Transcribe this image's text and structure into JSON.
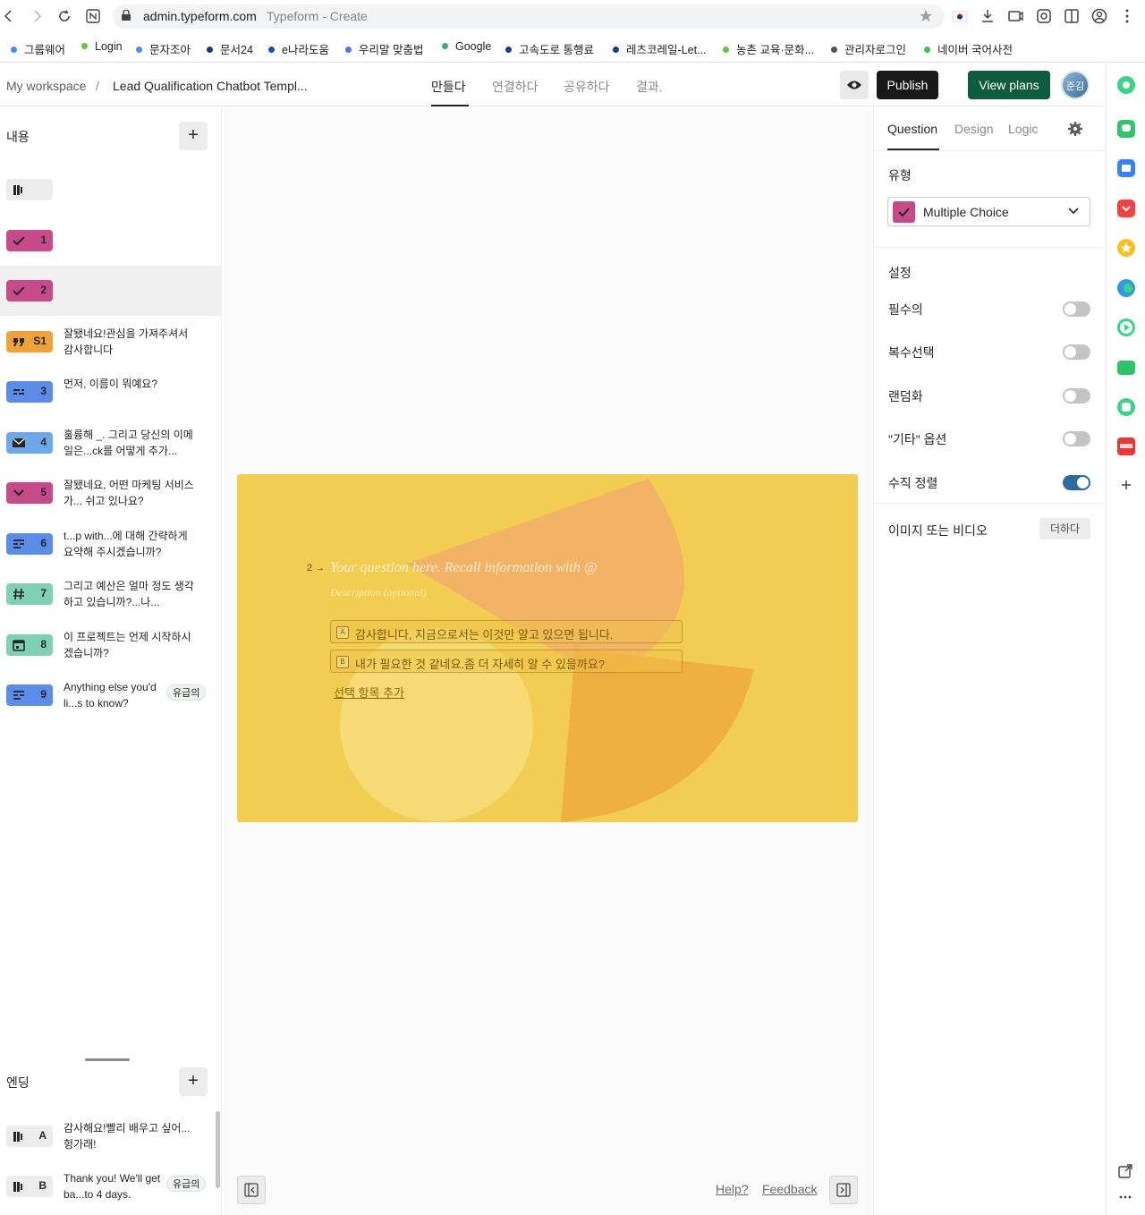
{
  "browser": {
    "url_domain": "admin.typeform.com",
    "page_title": "Typeform - Create",
    "bookmarks": [
      {
        "label": "그룹웨어",
        "color": "#4a8fe7"
      },
      {
        "label": "Login",
        "color": "#6abf4b"
      },
      {
        "label": "문자조아",
        "color": "#4a8fe7"
      },
      {
        "label": "문서24",
        "color": "#1c3a78"
      },
      {
        "label": "e나라도움",
        "color": "#1e4fa8"
      },
      {
        "label": "우리말 맞춤법",
        "color": "#5b6ee0"
      },
      {
        "label": "Google",
        "color": "#46a37a"
      },
      {
        "label": "고속도로 통행료",
        "color": "#1a3c82"
      },
      {
        "label": "레츠코레일-Let...",
        "color": "#1a3c82"
      },
      {
        "label": "농촌 교육·문화...",
        "color": "#6abf4b"
      },
      {
        "label": "관리자로그인",
        "color": "#555555"
      },
      {
        "label": "네이버 국어사전",
        "color": "#3cc35a"
      }
    ]
  },
  "header": {
    "workspace": "My workspace",
    "separator": "/",
    "form_name": "Lead Qualification Chatbot Templ...",
    "tabs": [
      "만들다",
      "연결하다",
      "공유하다",
      "결과."
    ],
    "publish_label": "Publish",
    "plans_label": "View plans",
    "avatar_text": "준김"
  },
  "left": {
    "content_label": "내용",
    "ending_label": "엔딩",
    "questions": [
      {
        "num": "",
        "text": "",
        "color": "#ececec",
        "icon": "welcome-screen-icon"
      },
      {
        "num": "1",
        "text": "",
        "color": "#c74b8b",
        "icon": "checkmark-icon"
      },
      {
        "num": "2",
        "text": "",
        "color": "#c74b8b",
        "icon": "checkmark-icon"
      },
      {
        "num": "S1",
        "text": "잘됐네요!관심을 가져주셔서 감사합니다",
        "color": "#f0a23a",
        "icon": "quote-icon"
      },
      {
        "num": "3",
        "text": "먼저, 이름이 뭐예요?",
        "color": "#5b8de8",
        "icon": "short-text-icon"
      },
      {
        "num": "4",
        "text": "훌륭해 _. 그리고 당신의 이메일은...ck를 어떻게 추가...",
        "color": "#6ea8e8",
        "icon": "email-icon"
      },
      {
        "num": "5",
        "text": "잘됐네요, 어떤 마케팅 서비스가... 쉬고 있나요?",
        "color": "#c74b8b",
        "icon": "dropdown-icon"
      },
      {
        "num": "6",
        "text": "t...p with...에 대해 간략하게 요약해 주시겠습니까?",
        "color": "#5b8de8",
        "icon": "long-text-icon"
      },
      {
        "num": "7",
        "text": "그리고 예산은 얼마 정도 생각하고 있습니까?...나...",
        "color": "#7fd0b4",
        "icon": "number-icon"
      },
      {
        "num": "8",
        "text": "이 프로젝트는 언제 시작하시겠습니까?",
        "color": "#7fd0b4",
        "icon": "calendar-icon"
      },
      {
        "num": "9",
        "text": "Anything else you'd li...s to know?",
        "color": "#5b8de8",
        "icon": "long-text-icon",
        "required": "유급의"
      }
    ],
    "endings": [
      {
        "num": "A",
        "text": "감사해요!빨리 배우고 싶어...헝가래!",
        "color": "#ececec",
        "icon": "ending-icon"
      },
      {
        "num": "B",
        "text": "Thank you! We'll get ba...to 4 days.",
        "color": "#ececec",
        "icon": "ending-icon",
        "required": "유급의"
      }
    ]
  },
  "canvas": {
    "question_number": "2 →",
    "question_placeholder": "Your question here. Recall information with @",
    "description_placeholder": "Description (optional)",
    "choices": [
      {
        "key": "A",
        "text": "감사합니다, 지금으로서는 이것만 알고 있으면 됩니다."
      },
      {
        "key": "B",
        "text": "내가 필요한 것 같네요.좀 더 자세히 알 수 있을까요?"
      }
    ],
    "add_choice": "선택 항목 추가",
    "help": "Help?",
    "feedback": "Feedback",
    "card_color": "#f2cd52"
  },
  "right": {
    "tabs": [
      "Question",
      "Design",
      "Logic"
    ],
    "type_label": "유형",
    "type_value": "Multiple Choice",
    "settings_label": "설정",
    "settings": [
      {
        "label": "필수의",
        "on": false
      },
      {
        "label": "복수선택",
        "on": false
      },
      {
        "label": "랜덤화",
        "on": false
      },
      {
        "label": "\"기타\" 옵션",
        "on": false
      },
      {
        "label": "수직 정렬",
        "on": true
      }
    ],
    "media_label": "이미지 또는 비디오",
    "media_button": "더하다"
  }
}
